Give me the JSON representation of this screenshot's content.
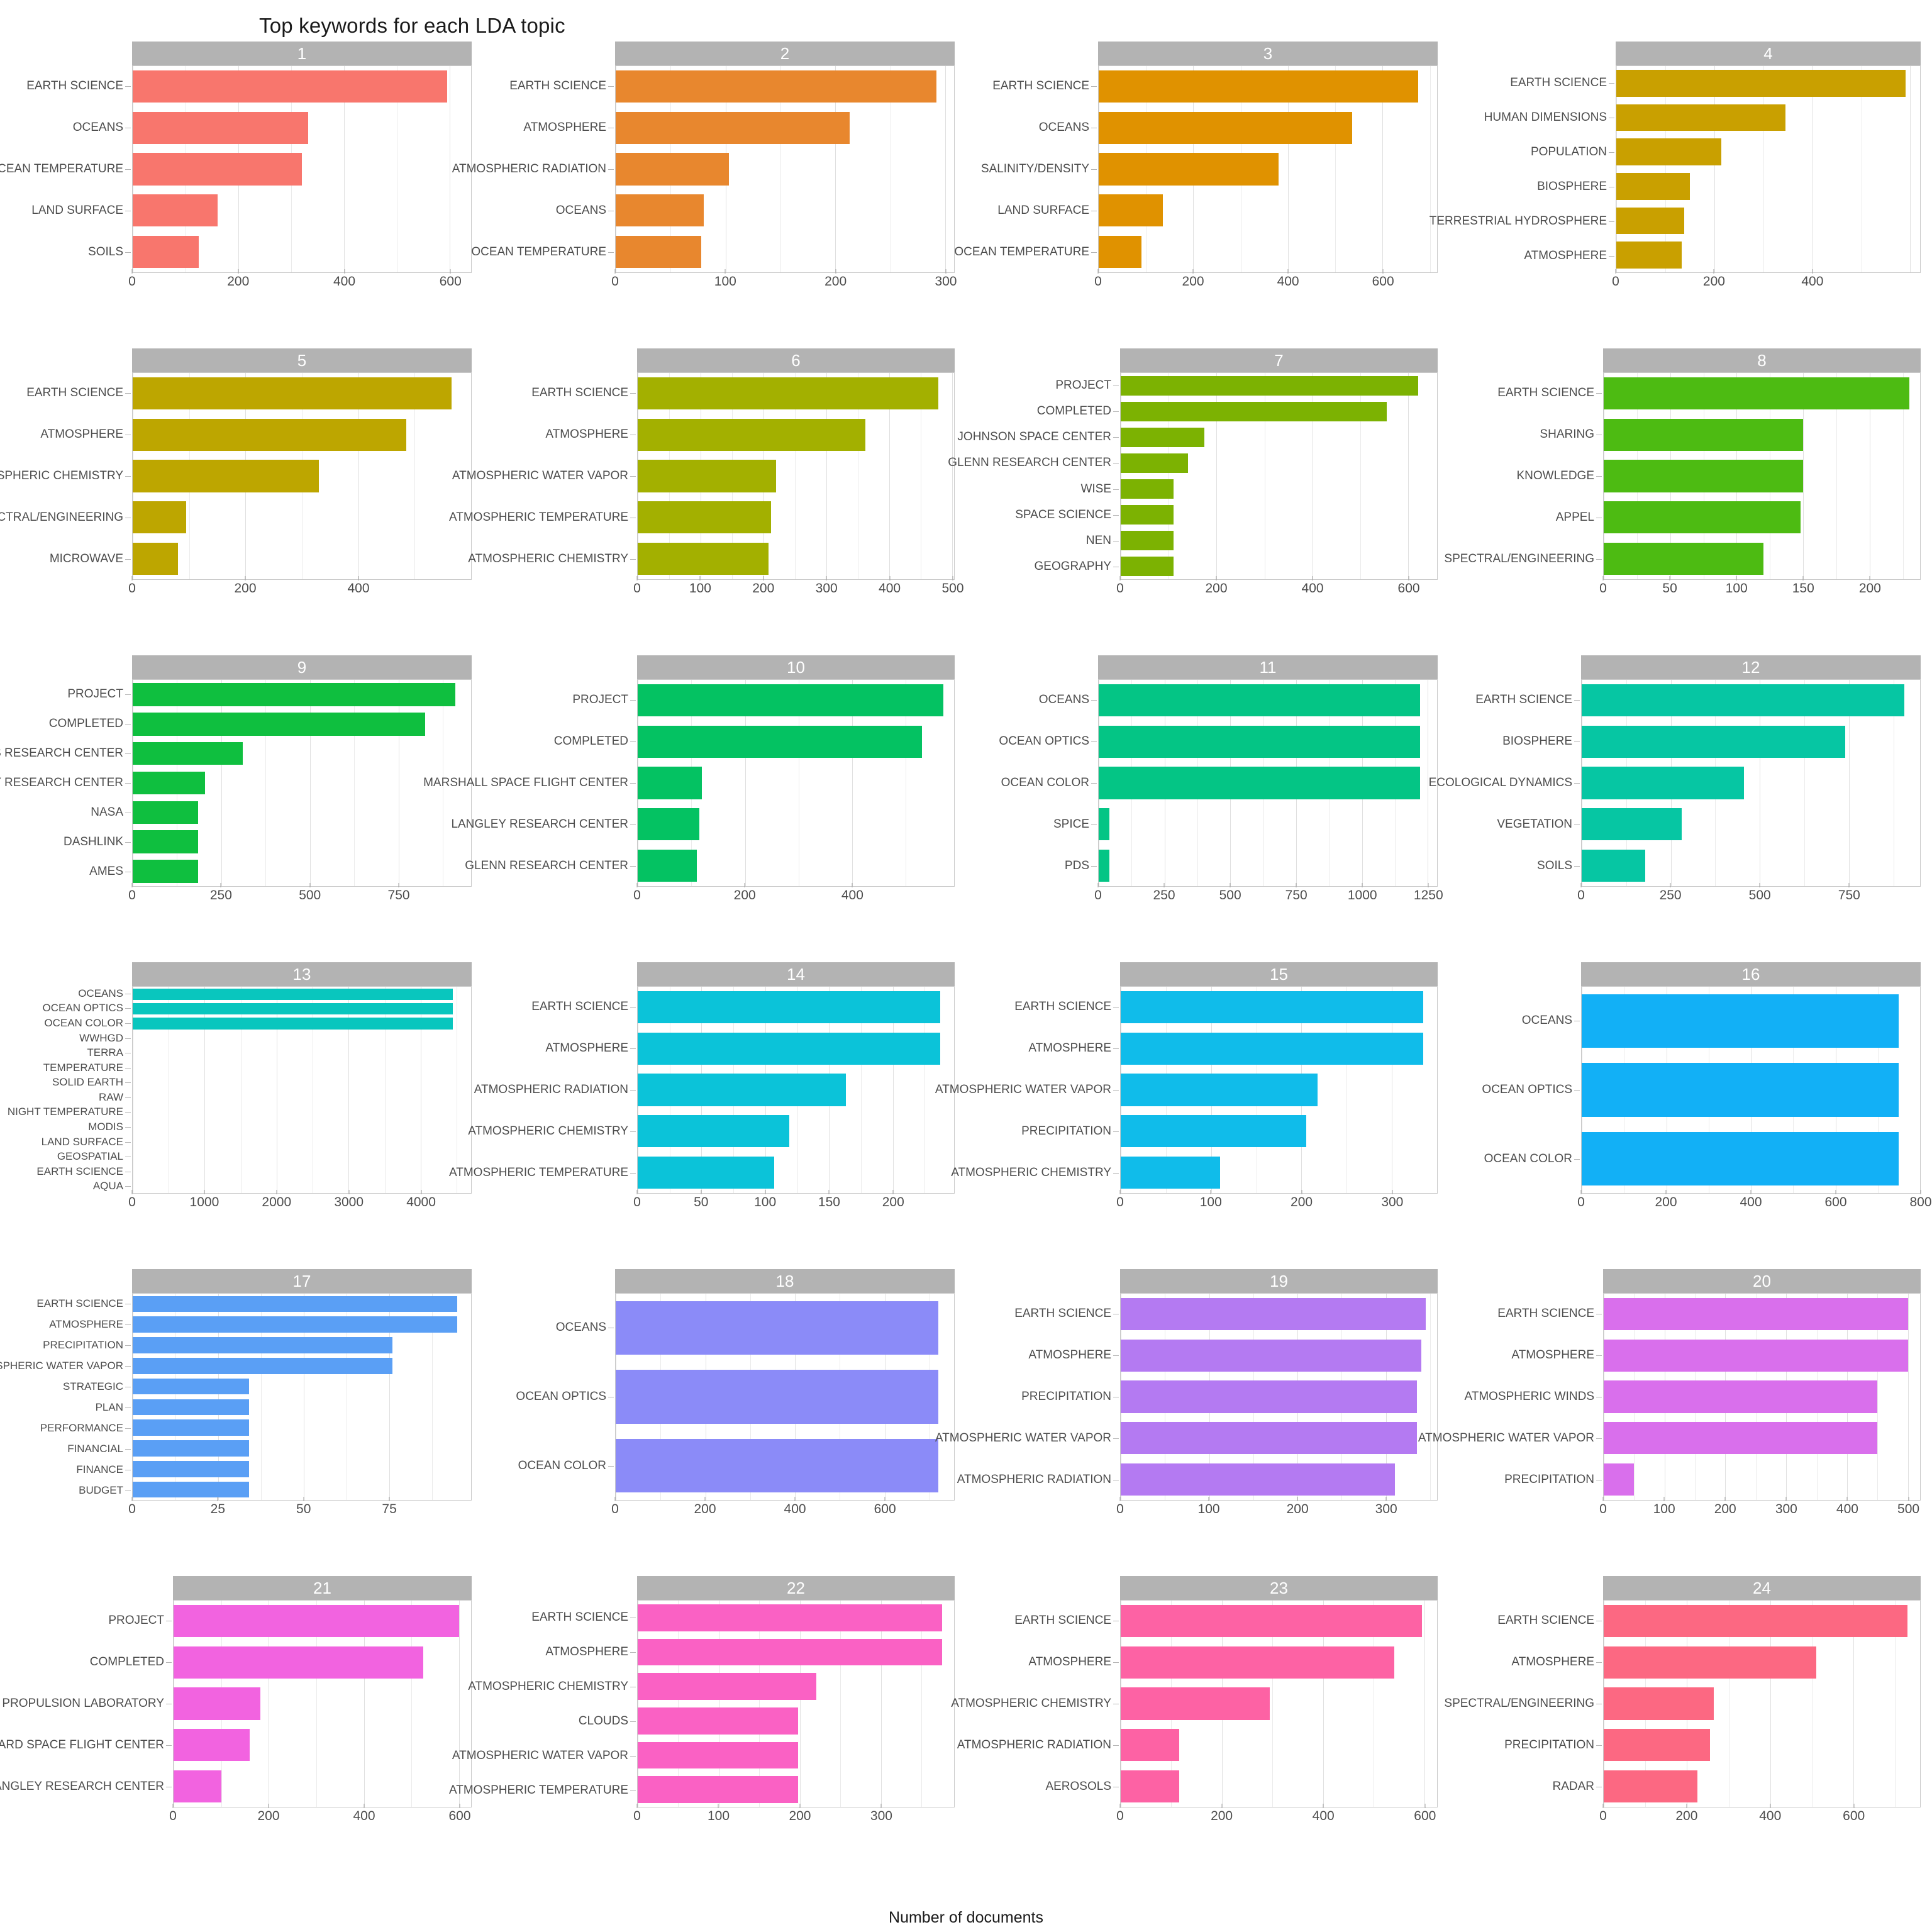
{
  "title": "Top keywords for each LDA topic",
  "xaxis_label": "Number of documents",
  "strip_bg": "#b3b3b3",
  "chart_data": {
    "type": "bar",
    "title": "Top keywords for each LDA topic",
    "xlabel": "Number of documents",
    "ylabel": "",
    "orientation": "horizontal",
    "facet_label": "LDA topic",
    "grid": true,
    "legend": "none",
    "panels": [
      {
        "topic": "1",
        "color": "#F8766D",
        "labelsize": 19,
        "labelwidth": 210,
        "xlim": [
          0,
          640
        ],
        "ticks": [
          0,
          200,
          400,
          600
        ],
        "categories": [
          "EARTH SCIENCE",
          "OCEANS",
          "OCEAN TEMPERATURE",
          "LAND SURFACE",
          "SOILS"
        ],
        "values": [
          595,
          332,
          320,
          160,
          125
        ]
      },
      {
        "topic": "2",
        "color": "#E8872E",
        "labelsize": 19,
        "labelwidth": 210,
        "xlim": [
          0,
          308
        ],
        "ticks": [
          0,
          100,
          200,
          300
        ],
        "categories": [
          "EARTH SCIENCE",
          "ATMOSPHERE",
          "ATMOSPHERIC RADIATION",
          "OCEANS",
          "OCEAN TEMPERATURE"
        ],
        "values": [
          292,
          213,
          103,
          80,
          78
        ]
      },
      {
        "topic": "3",
        "color": "#E09200",
        "labelsize": 19,
        "labelwidth": 210,
        "xlim": [
          0,
          715
        ],
        "ticks": [
          0,
          200,
          400,
          600
        ],
        "categories": [
          "EARTH SCIENCE",
          "OCEANS",
          "SALINITY/DENSITY",
          "LAND SURFACE",
          "OCEAN TEMPERATURE"
        ],
        "values": [
          675,
          535,
          380,
          135,
          90
        ]
      },
      {
        "topic": "4",
        "color": "#C9A000",
        "labelsize": 19,
        "labelwidth": 265,
        "xlim": [
          0,
          620
        ],
        "ticks": [
          0,
          200,
          400
        ],
        "categories": [
          "EARTH SCIENCE",
          "HUMAN DIMENSIONS",
          "POPULATION",
          "BIOSPHERE",
          "TERRESTRIAL HYDROSPHERE",
          "ATMOSPHERE"
        ],
        "values": [
          590,
          345,
          215,
          150,
          138,
          133
        ]
      },
      {
        "topic": "5",
        "color": "#BDA600",
        "labelsize": 19,
        "labelwidth": 210,
        "xlim": [
          0,
          600
        ],
        "ticks": [
          0,
          200,
          400
        ],
        "categories": [
          "EARTH SCIENCE",
          "ATMOSPHERE",
          "ATMOSPHERIC CHEMISTRY",
          "SPECTRAL/ENGINEERING",
          "MICROWAVE"
        ],
        "values": [
          565,
          485,
          330,
          95,
          80
        ]
      },
      {
        "topic": "6",
        "color": "#A3B000",
        "labelsize": 19,
        "labelwidth": 245,
        "xlim": [
          0,
          503
        ],
        "ticks": [
          0,
          100,
          200,
          300,
          400,
          500
        ],
        "categories": [
          "EARTH SCIENCE",
          "ATMOSPHERE",
          "ATMOSPHERIC WATER VAPOR",
          "ATMOSPHERIC TEMPERATURE",
          "ATMOSPHERIC CHEMISTRY"
        ],
        "values": [
          478,
          362,
          220,
          212,
          208
        ]
      },
      {
        "topic": "7",
        "color": "#7CB202",
        "labelsize": 19,
        "labelwidth": 245,
        "xlim": [
          0,
          660
        ],
        "ticks": [
          0,
          200,
          400,
          600
        ],
        "categories": [
          "PROJECT",
          "COMPLETED",
          "JOHNSON SPACE CENTER",
          "GLENN RESEARCH CENTER",
          "WISE",
          "SPACE SCIENCE",
          "NEN",
          "GEOGRAPHY"
        ],
        "values": [
          620,
          555,
          175,
          140,
          110,
          110,
          110,
          110
        ]
      },
      {
        "topic": "8",
        "color": "#4DBB12",
        "labelsize": 19,
        "labelwidth": 245,
        "xlim": [
          0,
          238
        ],
        "ticks": [
          0,
          50,
          100,
          150,
          200
        ],
        "categories": [
          "EARTH SCIENCE",
          "SHARING",
          "KNOWLEDGE",
          "APPEL",
          "SPECTRAL/ENGINEERING"
        ],
        "values": [
          230,
          150,
          150,
          148,
          120
        ]
      },
      {
        "topic": "9",
        "color": "#0FBF3F",
        "labelsize": 19,
        "labelwidth": 210,
        "xlim": [
          0,
          955
        ],
        "ticks": [
          0,
          250,
          500,
          750
        ],
        "categories": [
          "PROJECT",
          "COMPLETED",
          "AMES RESEARCH CENTER",
          "LANGLEY RESEARCH CENTER",
          "NASA",
          "DASHLINK",
          "AMES"
        ],
        "values": [
          910,
          825,
          310,
          205,
          185,
          185,
          185
        ]
      },
      {
        "topic": "10",
        "color": "#04C262",
        "labelsize": 19,
        "labelwidth": 245,
        "xlim": [
          0,
          590
        ],
        "ticks": [
          0,
          200,
          400
        ],
        "categories": [
          "PROJECT",
          "COMPLETED",
          "MARSHALL SPACE FLIGHT CENTER",
          "LANGLEY RESEARCH CENTER",
          "GLENN RESEARCH CENTER"
        ],
        "values": [
          570,
          530,
          120,
          115,
          110
        ]
      },
      {
        "topic": "11",
        "color": "#04C585",
        "labelsize": 19,
        "labelwidth": 210,
        "xlim": [
          0,
          1285
        ],
        "ticks": [
          0,
          250,
          500,
          750,
          1000,
          1250
        ],
        "categories": [
          "OCEANS",
          "OCEAN OPTICS",
          "OCEAN COLOR",
          "SPICE",
          "PDS"
        ],
        "values": [
          1220,
          1220,
          1220,
          40,
          40
        ]
      },
      {
        "topic": "12",
        "color": "#06C6A3",
        "labelsize": 19,
        "labelwidth": 210,
        "xlim": [
          0,
          950
        ],
        "ticks": [
          0,
          250,
          500,
          750
        ],
        "categories": [
          "EARTH SCIENCE",
          "BIOSPHERE",
          "ECOLOGICAL DYNAMICS",
          "VEGETATION",
          "SOILS"
        ],
        "values": [
          905,
          740,
          455,
          280,
          178
        ]
      },
      {
        "topic": "13",
        "color": "#09C6BE",
        "labelsize": 17,
        "labelwidth": 210,
        "xlim": [
          0,
          4700
        ],
        "ticks": [
          0,
          1000,
          2000,
          3000,
          4000
        ],
        "categories": [
          "OCEANS",
          "OCEAN OPTICS",
          "OCEAN COLOR",
          "WWHGD",
          "TERRA",
          "TEMPERATURE",
          "SOLID EARTH",
          "RAW",
          "NIGHT TEMPERATURE",
          "MODIS",
          "LAND SURFACE",
          "GEOSPATIAL",
          "EARTH SCIENCE",
          "AQUA"
        ],
        "values": [
          4450,
          4450,
          4450,
          0,
          0,
          0,
          0,
          0,
          0,
          0,
          0,
          0,
          0,
          0
        ]
      },
      {
        "topic": "14",
        "color": "#0BC3D9",
        "labelsize": 19,
        "labelwidth": 245,
        "xlim": [
          0,
          248
        ],
        "ticks": [
          0,
          50,
          100,
          150,
          200
        ],
        "categories": [
          "EARTH SCIENCE",
          "ATMOSPHERE",
          "ATMOSPHERIC RADIATION",
          "ATMOSPHERIC CHEMISTRY",
          "ATMOSPHERIC TEMPERATURE"
        ],
        "values": [
          237,
          237,
          163,
          119,
          107
        ]
      },
      {
        "topic": "15",
        "color": "#10BCEA",
        "labelsize": 19,
        "labelwidth": 245,
        "xlim": [
          0,
          350
        ],
        "ticks": [
          0,
          100,
          200,
          300
        ],
        "categories": [
          "EARTH SCIENCE",
          "ATMOSPHERE",
          "ATMOSPHERIC WATER VAPOR",
          "PRECIPITATION",
          "ATMOSPHERIC CHEMISTRY"
        ],
        "values": [
          335,
          335,
          218,
          205,
          110
        ]
      },
      {
        "topic": "16",
        "color": "#12B0F6",
        "labelsize": 19,
        "labelwidth": 210,
        "xlim": [
          0,
          800
        ],
        "ticks": [
          0,
          200,
          400,
          600,
          800
        ],
        "categories": [
          "OCEANS",
          "OCEAN OPTICS",
          "OCEAN COLOR"
        ],
        "values": [
          750,
          750,
          750
        ]
      },
      {
        "topic": "17",
        "color": "#5A9FF5",
        "labelsize": 17,
        "labelwidth": 210,
        "xlim": [
          0,
          99
        ],
        "ticks": [
          0,
          25,
          50,
          75
        ],
        "categories": [
          "EARTH SCIENCE",
          "ATMOSPHERE",
          "PRECIPITATION",
          "ATMOSPHERIC WATER VAPOR",
          "STRATEGIC",
          "PLAN",
          "PERFORMANCE",
          "FINANCIAL",
          "FINANCE",
          "BUDGET"
        ],
        "values": [
          95,
          95,
          76,
          76,
          34,
          34,
          34,
          34,
          34,
          34
        ]
      },
      {
        "topic": "18",
        "color": "#8B8BF8",
        "labelsize": 19,
        "labelwidth": 210,
        "xlim": [
          0,
          755
        ],
        "ticks": [
          0,
          200,
          400,
          600
        ],
        "categories": [
          "OCEANS",
          "OCEAN OPTICS",
          "OCEAN COLOR"
        ],
        "values": [
          720,
          720,
          720
        ]
      },
      {
        "topic": "19",
        "color": "#B47AF2",
        "labelsize": 19,
        "labelwidth": 245,
        "xlim": [
          0,
          358
        ],
        "ticks": [
          0,
          100,
          200,
          300
        ],
        "categories": [
          "EARTH SCIENCE",
          "ATMOSPHERE",
          "PRECIPITATION",
          "ATMOSPHERIC WATER VAPOR",
          "ATMOSPHERIC RADIATION"
        ],
        "values": [
          345,
          340,
          335,
          335,
          310
        ]
      },
      {
        "topic": "20",
        "color": "#D96FEC",
        "labelsize": 19,
        "labelwidth": 245,
        "xlim": [
          0,
          520
        ],
        "ticks": [
          0,
          100,
          200,
          300,
          400,
          500
        ],
        "categories": [
          "EARTH SCIENCE",
          "ATMOSPHERE",
          "ATMOSPHERIC WINDS",
          "ATMOSPHERIC WATER VAPOR",
          "PRECIPITATION"
        ],
        "values": [
          500,
          500,
          450,
          450,
          50
        ]
      },
      {
        "topic": "21",
        "color": "#F263E0",
        "labelsize": 19,
        "labelwidth": 275,
        "xlim": [
          0,
          625
        ],
        "ticks": [
          0,
          200,
          400,
          600
        ],
        "categories": [
          "PROJECT",
          "COMPLETED",
          "JET PROPULSION LABORATORY",
          "GODDARD SPACE FLIGHT CENTER",
          "LANGLEY RESEARCH CENTER"
        ],
        "values": [
          600,
          525,
          183,
          160,
          100
        ]
      },
      {
        "topic": "22",
        "color": "#FA61C4",
        "labelsize": 19,
        "labelwidth": 245,
        "xlim": [
          0,
          390
        ],
        "ticks": [
          0,
          100,
          200,
          300
        ],
        "categories": [
          "EARTH SCIENCE",
          "ATMOSPHERE",
          "ATMOSPHERIC CHEMISTRY",
          "CLOUDS",
          "ATMOSPHERIC WATER VAPOR",
          "ATMOSPHERIC TEMPERATURE"
        ],
        "values": [
          375,
          375,
          220,
          198,
          198,
          198
        ]
      },
      {
        "topic": "23",
        "color": "#FD62A4",
        "labelsize": 19,
        "labelwidth": 245,
        "xlim": [
          0,
          625
        ],
        "ticks": [
          0,
          200,
          400,
          600
        ],
        "categories": [
          "EARTH SCIENCE",
          "ATMOSPHERE",
          "ATMOSPHERIC CHEMISTRY",
          "ATMOSPHERIC RADIATION",
          "AEROSOLS"
        ],
        "values": [
          595,
          540,
          295,
          115,
          115
        ]
      },
      {
        "topic": "24",
        "color": "#FC6882",
        "labelsize": 19,
        "labelwidth": 245,
        "xlim": [
          0,
          760
        ],
        "ticks": [
          0,
          200,
          400,
          600
        ],
        "categories": [
          "EARTH SCIENCE",
          "ATMOSPHERE",
          "SPECTRAL/ENGINEERING",
          "PRECIPITATION",
          "RADAR"
        ],
        "values": [
          730,
          510,
          265,
          255,
          225
        ]
      }
    ]
  }
}
